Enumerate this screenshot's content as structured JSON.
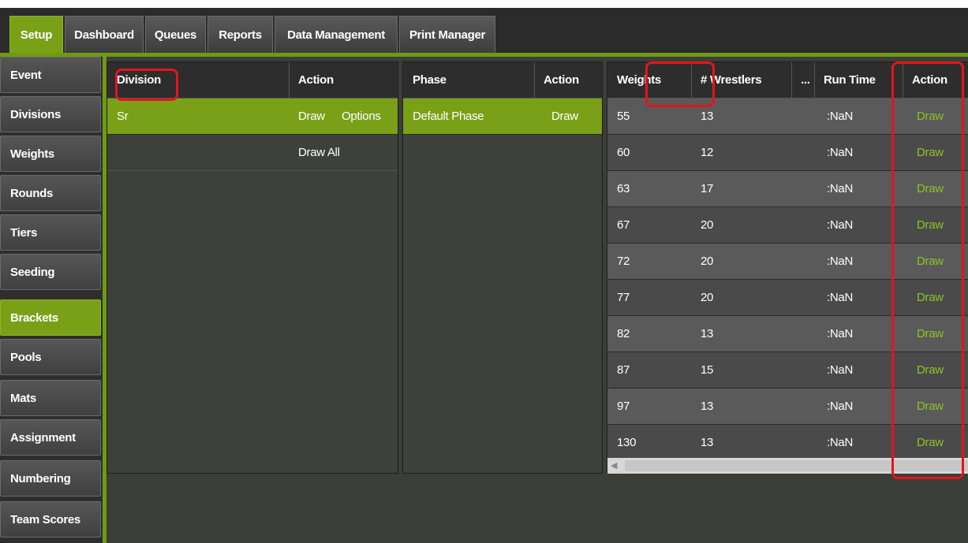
{
  "top_tabs": [
    {
      "label": "Setup",
      "active": true
    },
    {
      "label": "Dashboard",
      "active": false
    },
    {
      "label": "Queues",
      "active": false
    },
    {
      "label": "Reports",
      "active": false
    },
    {
      "label": "Data Management",
      "active": false
    },
    {
      "label": "Print Manager",
      "active": false
    }
  ],
  "side_nav": [
    {
      "label": "Event",
      "active": false
    },
    {
      "label": "Divisions",
      "active": false
    },
    {
      "label": "Weights",
      "active": false
    },
    {
      "label": "Rounds",
      "active": false
    },
    {
      "label": "Tiers",
      "active": false
    },
    {
      "label": "Seeding",
      "active": false
    },
    {
      "label": "Brackets",
      "active": true
    },
    {
      "label": "Pools",
      "active": false
    },
    {
      "label": "Mats",
      "active": false
    },
    {
      "label": "Assignment",
      "active": false
    },
    {
      "label": "Numbering",
      "active": false
    },
    {
      "label": "Team Scores",
      "active": false
    }
  ],
  "division_panel": {
    "headers": {
      "division": "Division",
      "action": "Action"
    },
    "rows": [
      {
        "division": "Sr",
        "action_draw": "Draw",
        "action_options": "Options",
        "selected": true
      },
      {
        "division": "",
        "action_draw": "Draw All",
        "action_options": "",
        "selected": false
      }
    ]
  },
  "phase_panel": {
    "headers": {
      "phase": "Phase",
      "action": "Action"
    },
    "rows": [
      {
        "phase": "Default Phase",
        "action": "Draw",
        "selected": true
      }
    ]
  },
  "weights_panel": {
    "headers": {
      "weights": "Weights",
      "wrestlers": "# Wrestlers",
      "more": "...",
      "run_time": "Run Time",
      "action": "Action"
    },
    "rows": [
      {
        "weight": "55",
        "wrestlers": "13",
        "run_time": ":NaN",
        "action": "Draw"
      },
      {
        "weight": "60",
        "wrestlers": "12",
        "run_time": ":NaN",
        "action": "Draw"
      },
      {
        "weight": "63",
        "wrestlers": "17",
        "run_time": ":NaN",
        "action": "Draw"
      },
      {
        "weight": "67",
        "wrestlers": "20",
        "run_time": ":NaN",
        "action": "Draw"
      },
      {
        "weight": "72",
        "wrestlers": "20",
        "run_time": ":NaN",
        "action": "Draw"
      },
      {
        "weight": "77",
        "wrestlers": "20",
        "run_time": ":NaN",
        "action": "Draw"
      },
      {
        "weight": "82",
        "wrestlers": "13",
        "run_time": ":NaN",
        "action": "Draw"
      },
      {
        "weight": "87",
        "wrestlers": "15",
        "run_time": ":NaN",
        "action": "Draw"
      },
      {
        "weight": "97",
        "wrestlers": "13",
        "run_time": ":NaN",
        "action": "Draw"
      },
      {
        "weight": "130",
        "wrestlers": "13",
        "run_time": ":NaN",
        "action": "Draw"
      }
    ]
  },
  "colors": {
    "accent": "#7aa018",
    "link": "#8cc424",
    "annotation": "#e5141b"
  }
}
